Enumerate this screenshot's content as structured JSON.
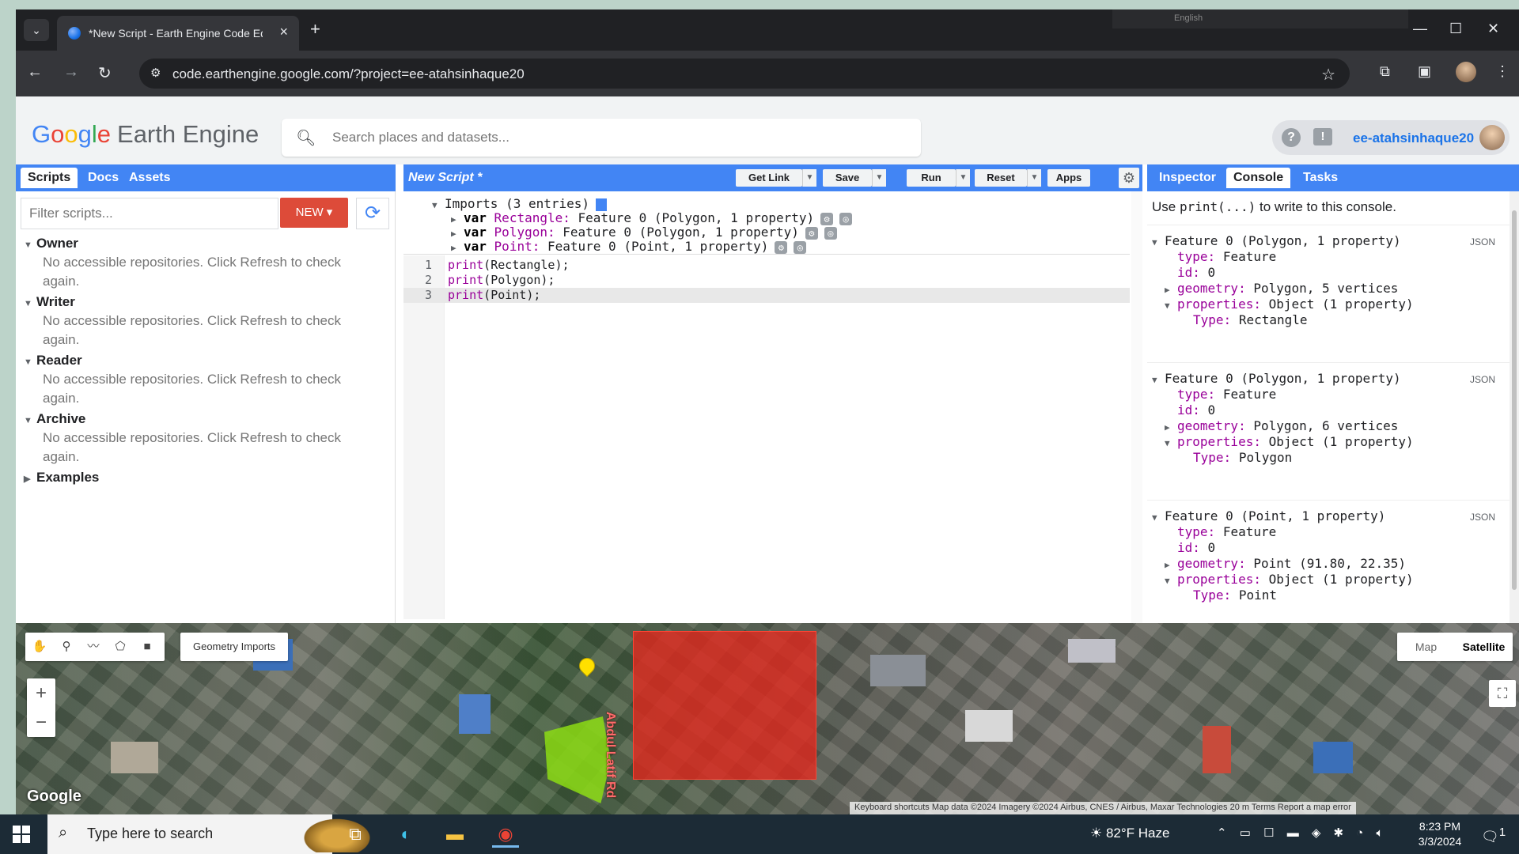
{
  "browser": {
    "tab_title": "*New Script - Earth Engine Code Editor",
    "new_tab": "+",
    "lang_indicator": "English",
    "url": "code.earthengine.google.com/?project=ee-atahsinhaque20",
    "window_controls": [
      "—",
      "☐",
      "✕"
    ]
  },
  "header": {
    "logo_google": [
      "G",
      "o",
      "o",
      "g",
      "l",
      "e"
    ],
    "logo_product": "Earth Engine",
    "search_placeholder": "Search places and datasets...",
    "help_icon": "?",
    "feedback_icon": "!",
    "username": "ee-atahsinhaque20"
  },
  "left_panel": {
    "tabs": [
      "Scripts",
      "Docs",
      "Assets"
    ],
    "filter_placeholder": "Filter scripts...",
    "new_button": "NEW ▾",
    "groups": [
      {
        "title": "Owner",
        "message": "No accessible repositories. Click Refresh to check again."
      },
      {
        "title": "Writer",
        "message": "No accessible repositories. Click Refresh to check again."
      },
      {
        "title": "Reader",
        "message": "No accessible repositories. Click Refresh to check again."
      },
      {
        "title": "Archive",
        "message": "No accessible repositories. Click Refresh to check again."
      },
      {
        "title": "Examples",
        "message": ""
      }
    ]
  },
  "editor": {
    "title": "New Script *",
    "buttons": {
      "get_link": "Get Link",
      "save": "Save",
      "run": "Run",
      "reset": "Reset",
      "apps": "Apps"
    },
    "imports_header": "Imports (3 entries)",
    "imports": [
      {
        "kw": "var",
        "name": "Rectangle:",
        "desc": "Feature 0 (Polygon, 1 property)"
      },
      {
        "kw": "var",
        "name": "Polygon:",
        "desc": "Feature 0 (Polygon, 1 property)"
      },
      {
        "kw": "var",
        "name": "Point:",
        "desc": "Feature 0 (Point, 1 property)"
      }
    ],
    "lines": [
      {
        "num": "1",
        "fn": "print",
        "arg": "Rectangle",
        "end": ");"
      },
      {
        "num": "2",
        "fn": "print",
        "arg": "Polygon",
        "end": ");"
      },
      {
        "num": "3",
        "fn": "print",
        "arg": "Point",
        "end": ");"
      }
    ]
  },
  "right_panel": {
    "tabs": [
      "Inspector",
      "Console",
      "Tasks"
    ],
    "hint_pre": "Use ",
    "hint_code": "print(...)",
    "hint_post": " to write to this console.",
    "json_label": "JSON",
    "entries": [
      {
        "head": "Feature 0 (Polygon, 1 property)",
        "type": "Feature",
        "id": "0",
        "geometry": "Polygon, 5 vertices",
        "properties": "Object (1 property)",
        "ptype": "Rectangle"
      },
      {
        "head": "Feature 0 (Polygon, 1 property)",
        "type": "Feature",
        "id": "0",
        "geometry": "Polygon, 6 vertices",
        "properties": "Object (1 property)",
        "ptype": "Polygon"
      },
      {
        "head": "Feature 0 (Point, 1 property)",
        "type": "Feature",
        "id": "0",
        "geometry": "Point (91.80, 22.35)",
        "properties": "Object (1 property)",
        "ptype": "Point"
      }
    ],
    "keys": {
      "type": "type:",
      "id": "id:",
      "geometry": "geometry:",
      "properties": "properties:",
      "ptype": "Type:"
    }
  },
  "map": {
    "geometry_imports": "Geometry Imports",
    "zoom_in": "+",
    "zoom_out": "−",
    "map_types": [
      "Map",
      "Satellite"
    ],
    "road_label": "Abdul Latif Rd",
    "watermark": "Google",
    "attribution": "Keyboard shortcuts   Map data ©2024 Imagery ©2024 Airbus, CNES / Airbus, Maxar Technologies   20 m   Terms   Report a map error"
  },
  "taskbar": {
    "search_text": "Type here to search",
    "weather": "82°F  Haze",
    "time": "8:23 PM",
    "date": "3/3/2024",
    "notifications": "1"
  },
  "colors": {
    "accent": "#4285f4",
    "new_button": "#dd4b39",
    "rectangle": "#e6281e",
    "polygon": "#8cdc14",
    "point": "#ffe000"
  }
}
